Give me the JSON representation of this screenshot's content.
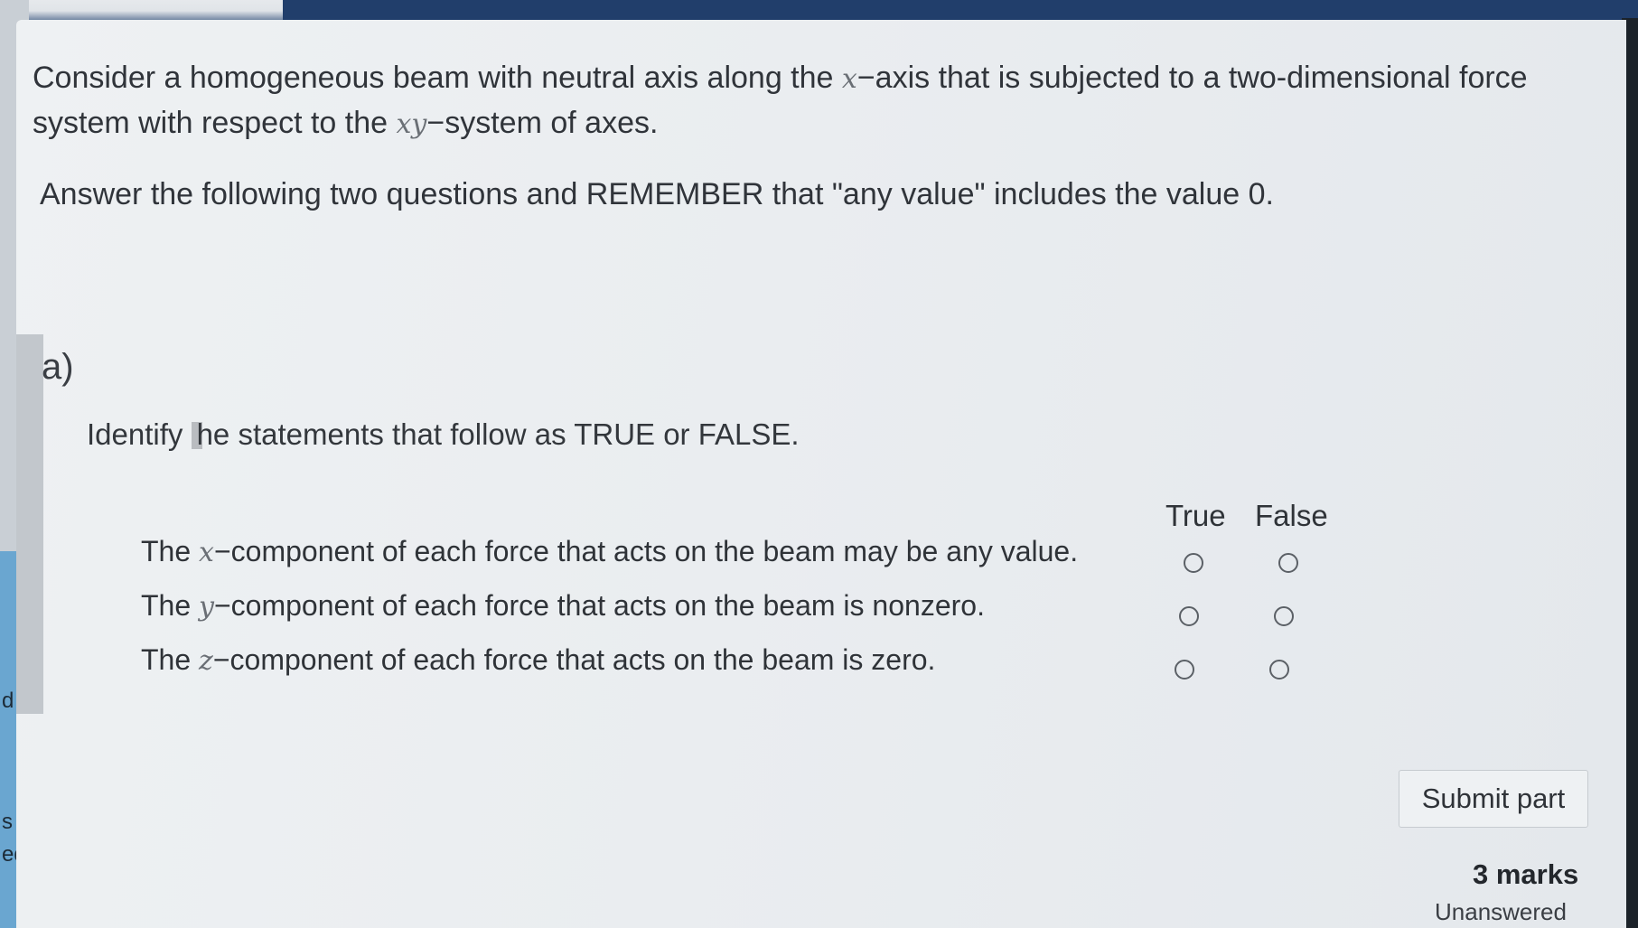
{
  "intro": {
    "part1": "Consider a homogeneous beam with neutral axis along the ",
    "x_var": "x",
    "part2": "−axis that is subjected to a two-dimensional force system with respect to the ",
    "xy_var": "xy",
    "part3": "−system of axes."
  },
  "note": "Answer the following two questions and REMEMBER that \"any value\" includes the value 0.",
  "part_label": "a)",
  "instruction": {
    "before": "Identify ",
    "after": "he statements that follow as TRUE or FALSE."
  },
  "columns": {
    "true_label": "True",
    "false_label": "False"
  },
  "statements": [
    {
      "pre": "The ",
      "var": "x",
      "post": "−component of each force that acts on the beam may be any value."
    },
    {
      "pre": "The ",
      "var": "y",
      "post": "−component of each force that acts on the beam is nonzero."
    },
    {
      "pre": "The ",
      "var": "z",
      "post": "−component of each force that acts on the beam is zero."
    }
  ],
  "submit_label": "Submit part",
  "marks": "3 marks",
  "status": "Unanswered",
  "left_fragments": {
    "a": "s",
    "b": "ed",
    "c": "d"
  }
}
